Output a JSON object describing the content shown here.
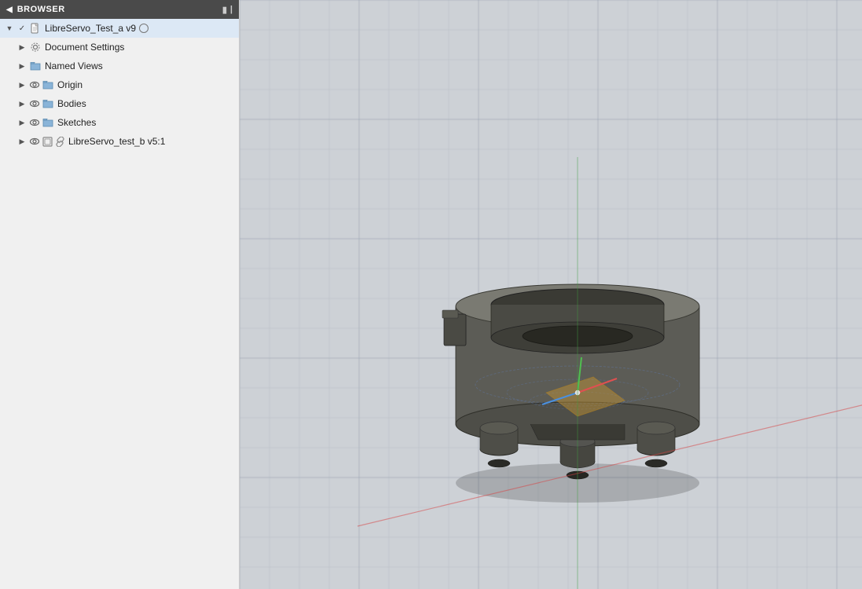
{
  "sidebar": {
    "header": {
      "title": "BROWSER",
      "collapse_icon": "◀",
      "pin_icon": "🔲"
    },
    "tree": [
      {
        "id": "root",
        "level": 0,
        "expand": "expanded",
        "icons": [
          "check-icon",
          "file-icon"
        ],
        "label": "LibreServo_Test_a v9",
        "extra_icon": "circle-icon"
      },
      {
        "id": "document-settings",
        "level": 1,
        "expand": "collapsed",
        "icons": [
          "gear-icon"
        ],
        "label": "Document Settings"
      },
      {
        "id": "named-views",
        "level": 1,
        "expand": "collapsed",
        "icons": [
          "folder-icon"
        ],
        "label": "Named Views"
      },
      {
        "id": "origin",
        "level": 1,
        "expand": "collapsed",
        "icons": [
          "eye-icon",
          "folder-icon"
        ],
        "label": "Origin"
      },
      {
        "id": "bodies",
        "level": 1,
        "expand": "collapsed",
        "icons": [
          "eye-icon",
          "folder-icon"
        ],
        "label": "Bodies"
      },
      {
        "id": "sketches",
        "level": 1,
        "expand": "collapsed",
        "icons": [
          "eye-icon",
          "folder-icon"
        ],
        "label": "Sketches"
      },
      {
        "id": "libreservo-b",
        "level": 1,
        "expand": "collapsed",
        "icons": [
          "eye-icon",
          "component-icon",
          "link-icon"
        ],
        "label": "LibreServo_test_b v5:1"
      }
    ]
  },
  "viewport": {
    "bg_color": "#d2d6db"
  }
}
